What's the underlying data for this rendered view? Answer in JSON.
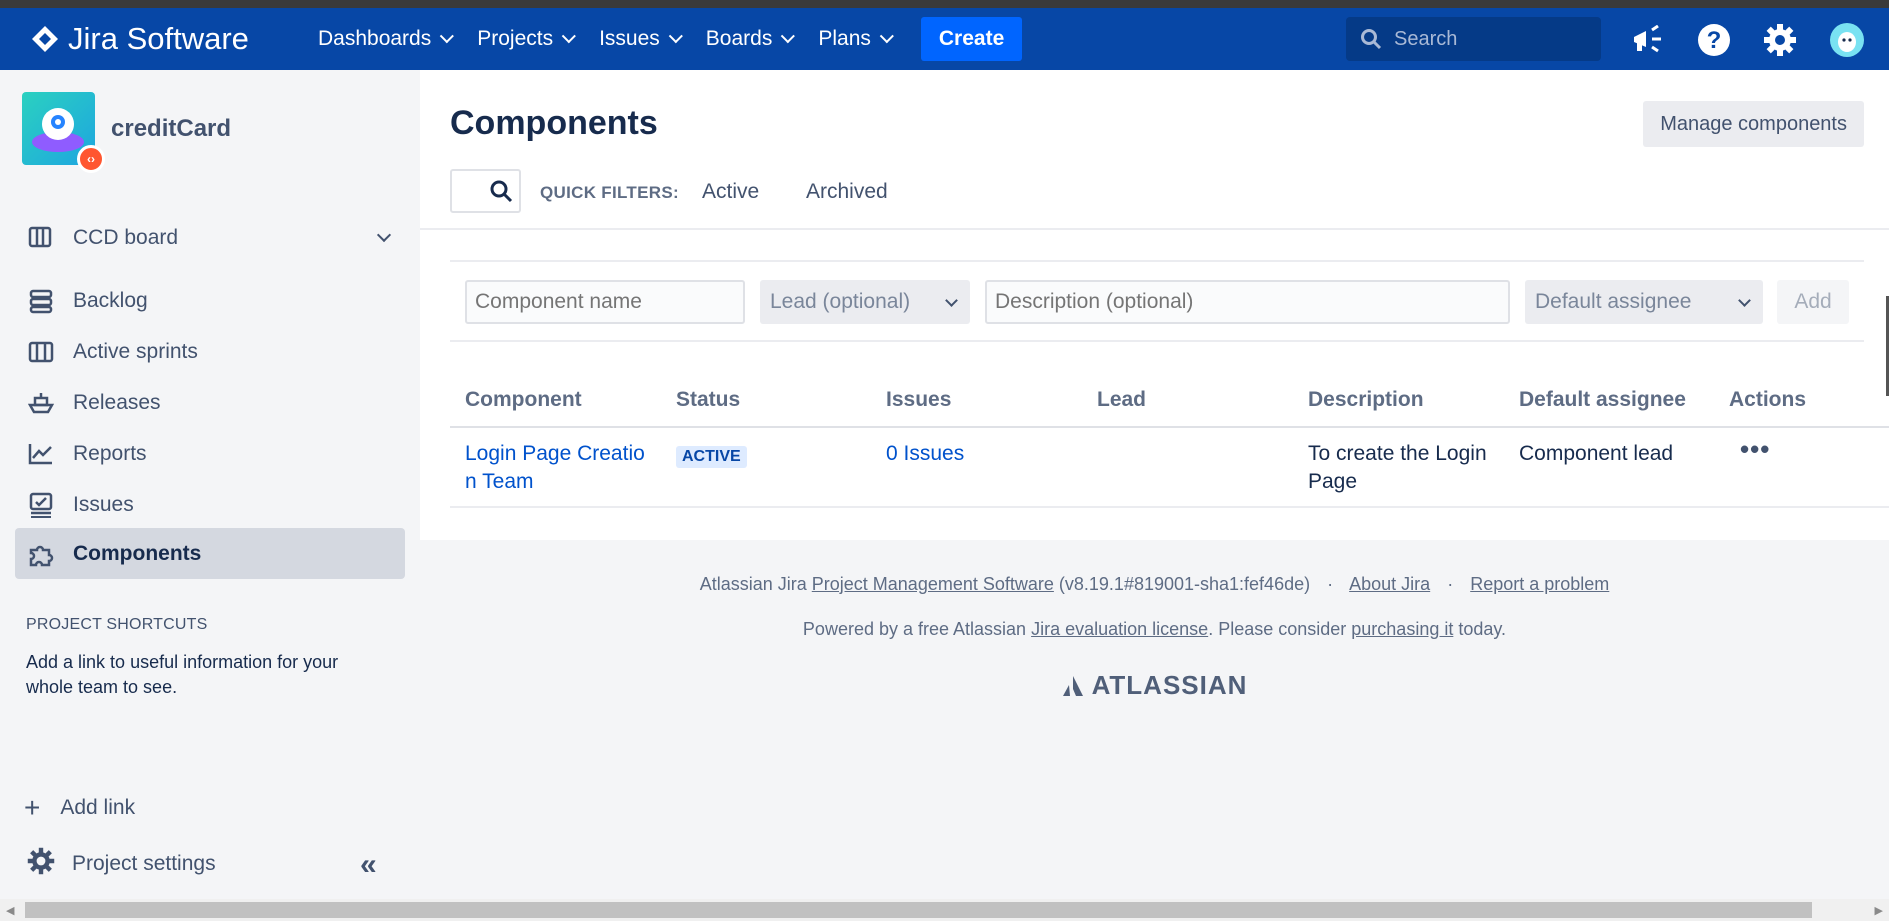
{
  "header": {
    "logo_text": "Jira Software",
    "nav": [
      "Dashboards",
      "Projects",
      "Issues",
      "Boards",
      "Plans"
    ],
    "create_label": "Create",
    "search_placeholder": "Search",
    "colors": {
      "header_bg": "#0747a6",
      "create_bg": "#0065ff"
    }
  },
  "sidebar": {
    "project_name": "creditCard",
    "board": "CCD board",
    "items": [
      {
        "label": "Backlog",
        "icon": "backlog-icon"
      },
      {
        "label": "Active sprints",
        "icon": "columns-icon"
      },
      {
        "label": "Releases",
        "icon": "ship-icon"
      },
      {
        "label": "Reports",
        "icon": "chart-icon"
      },
      {
        "label": "Issues",
        "icon": "issues-icon"
      },
      {
        "label": "Components",
        "icon": "puzzle-icon",
        "active": true
      }
    ],
    "shortcuts_title": "PROJECT SHORTCUTS",
    "shortcuts_text": "Add a link to useful information for your whole team to see.",
    "add_link": "Add link",
    "project_settings": "Project settings"
  },
  "main": {
    "title": "Components",
    "manage_button": "Manage components",
    "quick_filters_label": "QUICK FILTERS:",
    "quick_filters": [
      "Active",
      "Archived"
    ],
    "form": {
      "name_placeholder": "Component name",
      "lead_placeholder": "Lead (optional)",
      "description_placeholder": "Description (optional)",
      "assignee_placeholder": "Default assignee",
      "add_label": "Add"
    },
    "table": {
      "headers": [
        "Component",
        "Status",
        "Issues",
        "Lead",
        "Description",
        "Default assignee",
        "Actions"
      ],
      "rows": [
        {
          "component_line1": "Login Page Creatio",
          "component_line2": "n Team",
          "status": "ACTIVE",
          "issues": "0 Issues",
          "lead": "",
          "description_line1": "To create the Login",
          "description_line2": "Page",
          "default_assignee": "Component lead",
          "actions": "•••"
        }
      ]
    }
  },
  "footer": {
    "prefix": "Atlassian Jira",
    "pms_link": "Project Management Software",
    "version": "(v8.19.1#819001-sha1:fef46de)",
    "about": "About Jira",
    "report": "Report a problem",
    "powered_prefix": "Powered by a free Atlassian",
    "eval_link": "Jira evaluation license",
    "consider": ". Please consider",
    "purchase_link": "purchasing it",
    "today": "today.",
    "brand": "ATLASSIAN"
  }
}
